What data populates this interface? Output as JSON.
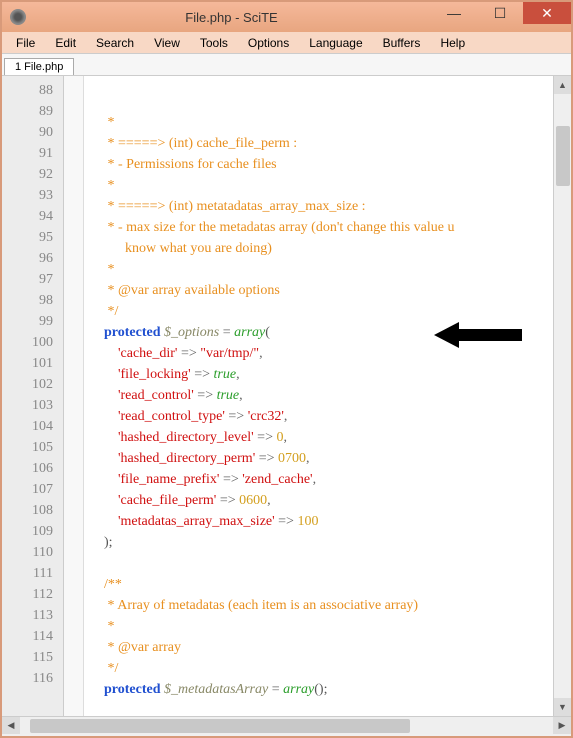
{
  "window": {
    "title": "File.php - SciTE"
  },
  "menubar": {
    "items": [
      "File",
      "Edit",
      "Search",
      "View",
      "Tools",
      "Options",
      "Language",
      "Buffers",
      "Help"
    ]
  },
  "tabs": {
    "items": [
      "1 File.php"
    ]
  },
  "gutter": {
    "start": 88,
    "end": 116
  },
  "code": {
    "lines": [
      {
        "tokens": [
          {
            "cls": "c-comment",
            "text": "     *"
          }
        ]
      },
      {
        "tokens": [
          {
            "cls": "c-comment",
            "text": "     * =====> (int) cache_file_perm :"
          }
        ]
      },
      {
        "tokens": [
          {
            "cls": "c-comment",
            "text": "     * - Permissions for cache files"
          }
        ]
      },
      {
        "tokens": [
          {
            "cls": "c-comment",
            "text": "     *"
          }
        ]
      },
      {
        "tokens": [
          {
            "cls": "c-comment",
            "text": "     * =====> (int) metatadatas_array_max_size :"
          }
        ]
      },
      {
        "tokens": [
          {
            "cls": "c-comment",
            "text": "     * - max size for the metadatas array (don't change this value u"
          }
        ]
      },
      {
        "tokens": [
          {
            "cls": "c-comment",
            "text": "          know what you are doing)"
          }
        ]
      },
      {
        "tokens": [
          {
            "cls": "c-comment",
            "text": "     *"
          }
        ]
      },
      {
        "tokens": [
          {
            "cls": "c-comment",
            "text": "     * @var array available options"
          }
        ]
      },
      {
        "tokens": [
          {
            "cls": "c-comment",
            "text": "     */"
          }
        ]
      },
      {
        "tokens": [
          {
            "cls": "",
            "text": "    "
          },
          {
            "cls": "c-keyword",
            "text": "protected"
          },
          {
            "cls": "",
            "text": " "
          },
          {
            "cls": "c-var",
            "text": "$_options"
          },
          {
            "cls": "",
            "text": " "
          },
          {
            "cls": "c-op",
            "text": "="
          },
          {
            "cls": "",
            "text": " "
          },
          {
            "cls": "c-func",
            "text": "array"
          },
          {
            "cls": "c-paren",
            "text": "("
          }
        ]
      },
      {
        "tokens": [
          {
            "cls": "",
            "text": "        "
          },
          {
            "cls": "c-string",
            "text": "'cache_dir'"
          },
          {
            "cls": "",
            "text": " "
          },
          {
            "cls": "c-op",
            "text": "=>"
          },
          {
            "cls": "",
            "text": " "
          },
          {
            "cls": "c-string",
            "text": "\"var/tmp/\""
          },
          {
            "cls": "c-op",
            "text": ","
          }
        ]
      },
      {
        "tokens": [
          {
            "cls": "",
            "text": "        "
          },
          {
            "cls": "c-string",
            "text": "'file_locking'"
          },
          {
            "cls": "",
            "text": " "
          },
          {
            "cls": "c-op",
            "text": "=>"
          },
          {
            "cls": "",
            "text": " "
          },
          {
            "cls": "c-func",
            "text": "true"
          },
          {
            "cls": "c-op",
            "text": ","
          }
        ]
      },
      {
        "tokens": [
          {
            "cls": "",
            "text": "        "
          },
          {
            "cls": "c-string",
            "text": "'read_control'"
          },
          {
            "cls": "",
            "text": " "
          },
          {
            "cls": "c-op",
            "text": "=>"
          },
          {
            "cls": "",
            "text": " "
          },
          {
            "cls": "c-func",
            "text": "true"
          },
          {
            "cls": "c-op",
            "text": ","
          }
        ]
      },
      {
        "tokens": [
          {
            "cls": "",
            "text": "        "
          },
          {
            "cls": "c-string",
            "text": "'read_control_type'"
          },
          {
            "cls": "",
            "text": " "
          },
          {
            "cls": "c-op",
            "text": "=>"
          },
          {
            "cls": "",
            "text": " "
          },
          {
            "cls": "c-string",
            "text": "'crc32'"
          },
          {
            "cls": "c-op",
            "text": ","
          }
        ]
      },
      {
        "tokens": [
          {
            "cls": "",
            "text": "        "
          },
          {
            "cls": "c-string",
            "text": "'hashed_directory_level'"
          },
          {
            "cls": "",
            "text": " "
          },
          {
            "cls": "c-op",
            "text": "=>"
          },
          {
            "cls": "",
            "text": " "
          },
          {
            "cls": "c-num",
            "text": "0"
          },
          {
            "cls": "c-op",
            "text": ","
          }
        ]
      },
      {
        "tokens": [
          {
            "cls": "",
            "text": "        "
          },
          {
            "cls": "c-string",
            "text": "'hashed_directory_perm'"
          },
          {
            "cls": "",
            "text": " "
          },
          {
            "cls": "c-op",
            "text": "=>"
          },
          {
            "cls": "",
            "text": " "
          },
          {
            "cls": "c-num",
            "text": "0700"
          },
          {
            "cls": "c-op",
            "text": ","
          }
        ]
      },
      {
        "tokens": [
          {
            "cls": "",
            "text": "        "
          },
          {
            "cls": "c-string",
            "text": "'file_name_prefix'"
          },
          {
            "cls": "",
            "text": " "
          },
          {
            "cls": "c-op",
            "text": "=>"
          },
          {
            "cls": "",
            "text": " "
          },
          {
            "cls": "c-string",
            "text": "'zend_cache'"
          },
          {
            "cls": "c-op",
            "text": ","
          }
        ]
      },
      {
        "tokens": [
          {
            "cls": "",
            "text": "        "
          },
          {
            "cls": "c-string",
            "text": "'cache_file_perm'"
          },
          {
            "cls": "",
            "text": " "
          },
          {
            "cls": "c-op",
            "text": "=>"
          },
          {
            "cls": "",
            "text": " "
          },
          {
            "cls": "c-num",
            "text": "0600"
          },
          {
            "cls": "c-op",
            "text": ","
          }
        ]
      },
      {
        "tokens": [
          {
            "cls": "",
            "text": "        "
          },
          {
            "cls": "c-string",
            "text": "'metadatas_array_max_size'"
          },
          {
            "cls": "",
            "text": " "
          },
          {
            "cls": "c-op",
            "text": "=>"
          },
          {
            "cls": "",
            "text": " "
          },
          {
            "cls": "c-num",
            "text": "100"
          }
        ]
      },
      {
        "tokens": [
          {
            "cls": "",
            "text": "    "
          },
          {
            "cls": "c-paren",
            "text": ");"
          }
        ]
      },
      {
        "tokens": [
          {
            "cls": "",
            "text": ""
          }
        ]
      },
      {
        "tokens": [
          {
            "cls": "c-comment",
            "text": "    /**"
          }
        ]
      },
      {
        "tokens": [
          {
            "cls": "c-comment",
            "text": "     * Array of metadatas (each item is an associative array)"
          }
        ]
      },
      {
        "tokens": [
          {
            "cls": "c-comment",
            "text": "     *"
          }
        ]
      },
      {
        "tokens": [
          {
            "cls": "c-comment",
            "text": "     * @var array"
          }
        ]
      },
      {
        "tokens": [
          {
            "cls": "c-comment",
            "text": "     */"
          }
        ]
      },
      {
        "tokens": [
          {
            "cls": "",
            "text": "    "
          },
          {
            "cls": "c-keyword",
            "text": "protected"
          },
          {
            "cls": "",
            "text": " "
          },
          {
            "cls": "c-var",
            "text": "$_metadatasArray"
          },
          {
            "cls": "",
            "text": " "
          },
          {
            "cls": "c-op",
            "text": "="
          },
          {
            "cls": "",
            "text": " "
          },
          {
            "cls": "c-func",
            "text": "array"
          },
          {
            "cls": "c-paren",
            "text": "();"
          }
        ]
      },
      {
        "tokens": [
          {
            "cls": "",
            "text": ""
          }
        ]
      }
    ]
  }
}
